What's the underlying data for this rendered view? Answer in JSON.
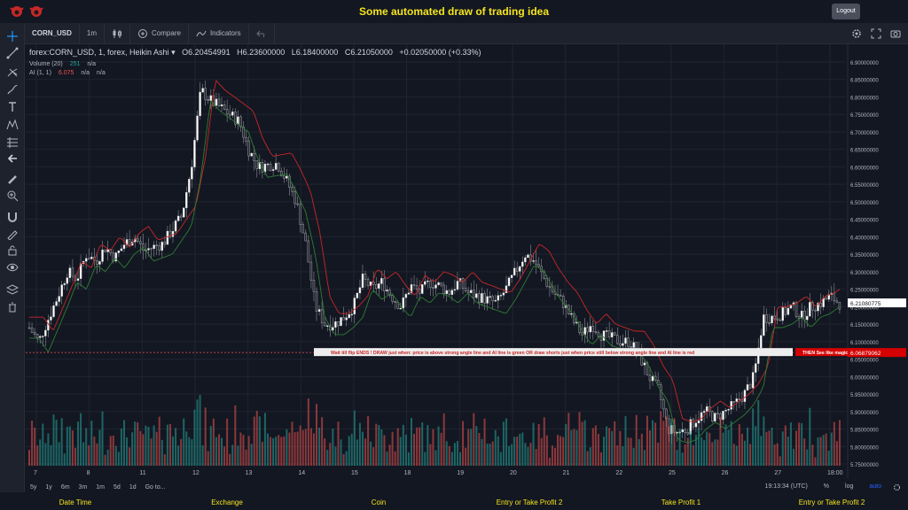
{
  "app": {
    "title": "Some automated draw of trading idea",
    "logout": "Logout"
  },
  "toolbar": {
    "symbol": "CORN_USD",
    "interval": "1m",
    "compare": "Compare",
    "indicators": "Indicators"
  },
  "legend": {
    "symbol_line": "forex:CORN_USD, 1, forex, Heikin Ashi",
    "open": "O6.20454991",
    "high": "H6.23600000",
    "low": "L6.18400000",
    "close": "C6.21050000",
    "change": "+0.02050000 (+0.33%)",
    "volume_label": "Volume (20)",
    "volume_value": "251",
    "volume_na": "n/a",
    "ai_label": "AI (1, 1)",
    "ai_value": "6.075",
    "ai_na1": "n/a",
    "ai_na2": "n/a"
  },
  "annotation": {
    "text": "Wait till flip ENDS  !   DRAW just when:  price is above strong angle line and AI line is green        OR        draw shorts just when price still below strong angle line and AI line is red",
    "magic": "THEN See like magic!!"
  },
  "price_labels": {
    "last": "6.21080775",
    "ai_line": "6.06879062"
  },
  "bottom": {
    "ranges": [
      "5y",
      "1y",
      "6m",
      "3m",
      "1m",
      "5d",
      "1d",
      "Go to..."
    ],
    "time": "19:13:34 (UTC)",
    "pct": "%",
    "log": "log",
    "auto": "auto"
  },
  "footer": {
    "items": [
      "Date Time",
      "Exchange",
      "Coin",
      "Entry or Take Profit 2",
      "Take Profit 1",
      "Entry or Take Profit 2"
    ]
  },
  "colors": {
    "background": "#131722",
    "up": "#26a69a",
    "down": "#ef5350",
    "title": "#f5e51c",
    "accent": "#2962ff"
  },
  "chart_data": {
    "type": "candlestick",
    "y_ticks": [
      "6.90000000",
      "6.85000000",
      "6.80000000",
      "6.75000000",
      "6.70000000",
      "6.65000000",
      "6.60000000",
      "6.55000000",
      "6.50000000",
      "6.45000000",
      "6.40000000",
      "6.35000000",
      "6.30000000",
      "6.25000000",
      "6.20000000",
      "6.15000000",
      "6.10000000",
      "6.05000000",
      "6.00000000",
      "5.95000000",
      "5.90000000",
      "5.85000000",
      "5.80000000",
      "5.75000000"
    ],
    "x_ticks": [
      "7",
      "8",
      "11",
      "12",
      "13",
      "14",
      "15",
      "18",
      "19",
      "20",
      "21",
      "22",
      "25",
      "26",
      "27",
      "18:00"
    ],
    "ylim": [
      5.745,
      6.905
    ],
    "close_path": [
      [
        0,
        6.14
      ],
      [
        1,
        6.1
      ],
      [
        3,
        6.23
      ],
      [
        4,
        6.3
      ],
      [
        5,
        6.28
      ],
      [
        6,
        6.35
      ],
      [
        7,
        6.33
      ],
      [
        8,
        6.37
      ],
      [
        9,
        6.34
      ],
      [
        10,
        6.38
      ],
      [
        11,
        6.4
      ],
      [
        12,
        6.36
      ],
      [
        14,
        6.38
      ],
      [
        16,
        6.46
      ],
      [
        17,
        6.6
      ],
      [
        18,
        6.82
      ],
      [
        19,
        6.79
      ],
      [
        20,
        6.77
      ],
      [
        22,
        6.73
      ],
      [
        23,
        6.65
      ],
      [
        24,
        6.6
      ],
      [
        26,
        6.61
      ],
      [
        27,
        6.56
      ],
      [
        28,
        6.5
      ],
      [
        29,
        6.38
      ],
      [
        30,
        6.2
      ],
      [
        31,
        6.15
      ],
      [
        32,
        6.15
      ],
      [
        33,
        6.17
      ],
      [
        34,
        6.2
      ],
      [
        35,
        6.28
      ],
      [
        36,
        6.25
      ],
      [
        37,
        6.27
      ],
      [
        38,
        6.23
      ],
      [
        39,
        6.2
      ],
      [
        40,
        6.26
      ],
      [
        41,
        6.24
      ],
      [
        42,
        6.27
      ],
      [
        43,
        6.26
      ],
      [
        44,
        6.24
      ],
      [
        45,
        6.27
      ],
      [
        46,
        6.24
      ],
      [
        47,
        6.23
      ],
      [
        48,
        6.22
      ],
      [
        49,
        6.21
      ],
      [
        50,
        6.25
      ],
      [
        51,
        6.3
      ],
      [
        52,
        6.35
      ],
      [
        53,
        6.33
      ],
      [
        54,
        6.28
      ],
      [
        55,
        6.24
      ],
      [
        56,
        6.21
      ],
      [
        57,
        6.16
      ],
      [
        58,
        6.12
      ],
      [
        59,
        6.15
      ],
      [
        60,
        6.12
      ],
      [
        61,
        6.11
      ],
      [
        62,
        6.1
      ],
      [
        63,
        6.1
      ],
      [
        64,
        6.06
      ],
      [
        65,
        6.0
      ],
      [
        66,
        5.96
      ],
      [
        67,
        5.85
      ],
      [
        68,
        5.84
      ],
      [
        69,
        5.85
      ],
      [
        70,
        5.88
      ],
      [
        71,
        5.9
      ],
      [
        72,
        5.88
      ],
      [
        73,
        5.9
      ],
      [
        74,
        5.92
      ],
      [
        75,
        5.95
      ],
      [
        76,
        6.0
      ],
      [
        77,
        6.17
      ],
      [
        78,
        6.17
      ],
      [
        79,
        6.18
      ],
      [
        80,
        6.2
      ],
      [
        81,
        6.17
      ],
      [
        82,
        6.2
      ],
      [
        83,
        6.21
      ],
      [
        84,
        6.23
      ],
      [
        85,
        6.21
      ]
    ]
  }
}
